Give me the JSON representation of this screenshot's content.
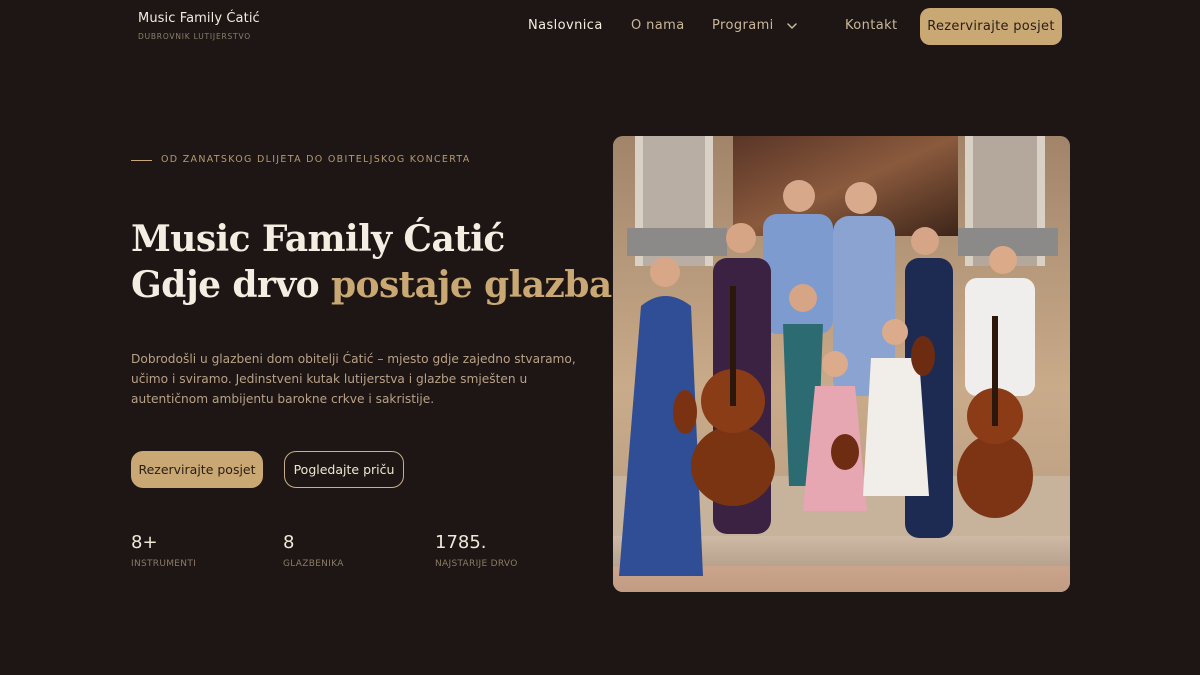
{
  "brand": {
    "name": "Music Family Ćatić",
    "tagline": "DUBROVNIK  LUTIJERSTVO"
  },
  "nav": {
    "items": [
      {
        "label": "Naslovnica",
        "active": true
      },
      {
        "label": "O nama",
        "active": false
      },
      {
        "label": "Programi",
        "active": false
      },
      {
        "label": "Kontakt",
        "active": false
      }
    ],
    "cta": "Rezervirajte posjet",
    "dropdown_icon": "chevron-down-icon"
  },
  "hero": {
    "eyebrow": "OD ZANATSKOG DLIJETA DO OBITELJSKOG KONCERTA",
    "title_line1": "Music Family Ćatić",
    "title_line2_plain": "Gdje drvo ",
    "title_line2_accent": "postaje glazba",
    "intro": "Dobrodošli u glazbeni dom obitelji Ćatić – mjesto gdje zajedno stvaramo, učimo i sviramo. Jedinstveni kutak lutijerstva i glazbe smješten u autentičnom ambijentu barokne crkve i sakristije.",
    "primary_button": "Rezervirajte posjet",
    "secondary_button": "Pogledajte priču",
    "stats": [
      {
        "value": "8+",
        "label": "INSTRUMENTI"
      },
      {
        "value": "8",
        "label": "GLAZBENIKA"
      },
      {
        "value": "1785.",
        "label": "NAJSTARIJE DRVO"
      }
    ]
  },
  "colors": {
    "background": "#1d1614",
    "accent": "#c9a874",
    "heading": "#f4ede2",
    "body_text": "#b8a187"
  }
}
